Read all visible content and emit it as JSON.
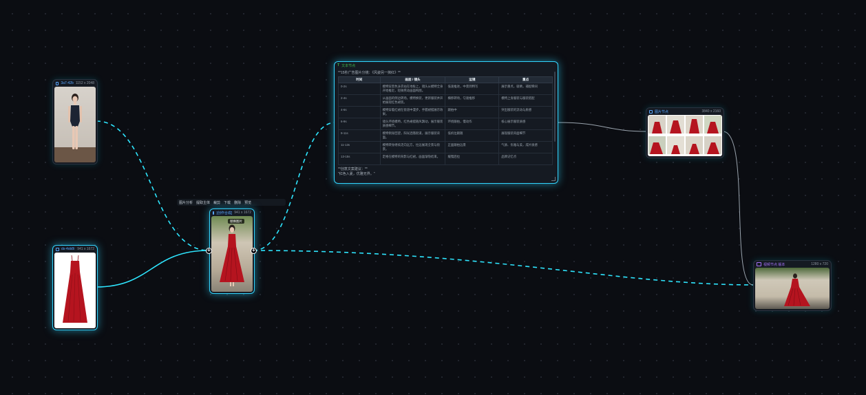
{
  "nodes": {
    "swimsuit": {
      "title": "3a7-42b",
      "size": "1152 x 2048"
    },
    "dress": {
      "title": "ds-4ob8i",
      "size": "941 x 1672"
    },
    "merged": {
      "title": "[创作合成]",
      "size": "941 x 1672",
      "overlay_button": "替换图片"
    },
    "text": {
      "title": "文本节点",
      "heading": "**15秒广告图片分镜：《风姿另一抹红》**",
      "columns": [
        "时间",
        "画面 / 镜头",
        "运镜",
        "重点"
      ],
      "rows": [
        [
          "0-2s",
          "模特穿黑色泳衣站在地板上，镜头从模特全身开始推近，轻微晃动画面构图。",
          "低速推进，中景到特写",
          "展示重点，吸睛，捕捉瞬间"
        ],
        [
          "2-4s",
          "从画面的侧边转场，模特换装，更新服装并开始展现红色裙装。",
          "横移转场，匀速推移",
          "模特上身服装与服装搭配"
        ],
        [
          "4-6s",
          "模特穿着红裙在街道中漫步，手握裙摆展示效果。",
          "跟拍中",
          "突出服装的流动与质感"
        ],
        [
          "6-9s",
          "镜头环绕模特，红色裙摆随风飘动，展示服装质感细节。",
          "环绕跟拍，慢动作",
          "核心展示服装质感"
        ],
        [
          "9-11s",
          "模特侧身回望，阳光洒落街道，展示服装背面。",
          "低机位跟随",
          "展现服装背面细节"
        ],
        [
          "11-13s",
          "模特转身继续走向远方，拉远展现全景与街景。",
          "正面跟拍远景",
          "气质、优雅与美，成片质感"
        ],
        [
          "13-15s",
          "定格在模特的背影与红裙，画面渐隐结束。",
          "缓慢后拉",
          "品牌记忆点"
        ]
      ],
      "footer": [
        "**创意文案建议：**",
        "\"红色入夏，优雅无界。\""
      ]
    },
    "grid": {
      "title": "图片节点",
      "size": "3840 x 2160"
    },
    "video": {
      "title": "视频节点 版本",
      "size": "1280 x 720"
    }
  },
  "toolbar": {
    "items": [
      "图片分析",
      "提取主体",
      "裁剪",
      "下载",
      "删除",
      "预览"
    ]
  },
  "colors": {
    "edge": "#2ee6ff",
    "edge_plain": "#9aa4ae",
    "accent": "#32d5ff",
    "dress_red": "#b5141f"
  },
  "icons": {
    "image_node": "image-icon",
    "text_node": "text-icon",
    "video_node": "video-icon",
    "port": "plus-icon"
  }
}
